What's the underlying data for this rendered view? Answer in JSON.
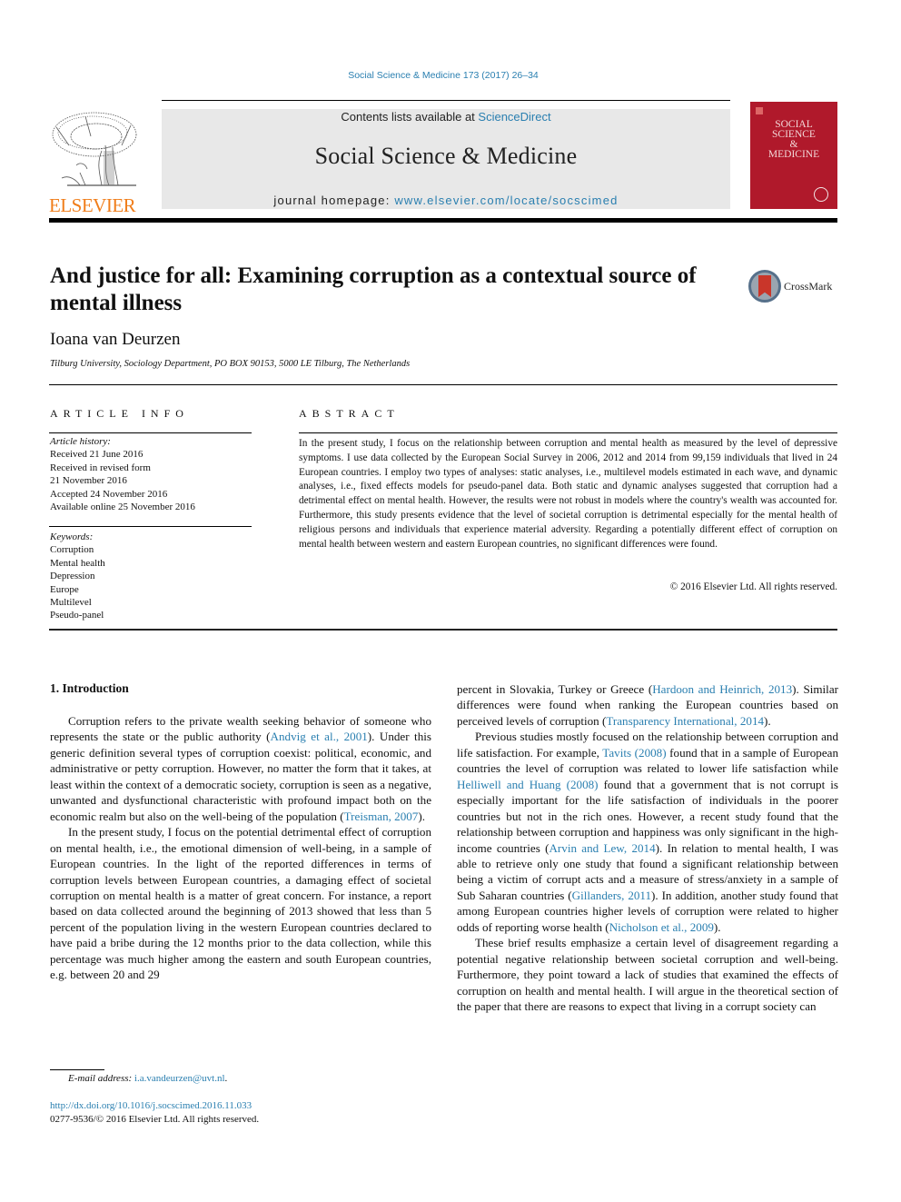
{
  "header": {
    "citation": "Social Science & Medicine 173 (2017) 26–34",
    "contents_prefix": "Contents lists available at ",
    "contents_link": "ScienceDirect",
    "journal_title": "Social Science & Medicine",
    "homepage_prefix": "journal homepage: ",
    "homepage_link": "www.elsevier.com/locate/socscimed",
    "publisher_logo_text": "ELSEVIER",
    "cover_title_lines": [
      "SOCIAL",
      "SCIENCE",
      "&",
      "MEDICINE"
    ],
    "crossmark_label": "CrossMark"
  },
  "colors": {
    "link": "#2a7fb0",
    "elsevier_orange": "#f07d1a",
    "cover_red": "#b0192b",
    "masthead_gray": "#e8e8e8"
  },
  "article": {
    "title": "And justice for all: Examining corruption as a contextual source of mental illness",
    "author": "Ioana van Deurzen",
    "affiliation": "Tilburg University, Sociology Department, PO BOX 90153, 5000 LE Tilburg, The Netherlands"
  },
  "article_info": {
    "heading": "ARTICLE INFO",
    "history_label": "Article history:",
    "history": [
      "Received 21 June 2016",
      "Received in revised form",
      "21 November 2016",
      "Accepted 24 November 2016",
      "Available online 25 November 2016"
    ],
    "keywords_label": "Keywords:",
    "keywords": [
      "Corruption",
      "Mental health",
      "Depression",
      "Europe",
      "Multilevel",
      "Pseudo-panel"
    ]
  },
  "abstract": {
    "heading": "ABSTRACT",
    "text": "In the present study, I focus on the relationship between corruption and mental health as measured by the level of depressive symptoms. I use data collected by the European Social Survey in 2006, 2012 and 2014 from 99,159 individuals that lived in 24 European countries. I employ two types of analyses: static analyses, i.e., multilevel models estimated in each wave, and dynamic analyses, i.e., fixed effects models for pseudo-panel data. Both static and dynamic analyses suggested that corruption had a detrimental effect on mental health. However, the results were not robust in models where the country's wealth was accounted for. Furthermore, this study presents evidence that the level of societal corruption is detrimental especially for the mental health of religious persons and individuals that experience material adversity. Regarding a potentially different effect of corruption on mental health between western and eastern European countries, no significant differences were found.",
    "copyright": "© 2016 Elsevier Ltd. All rights reserved."
  },
  "body": {
    "section_heading": "1.  Introduction",
    "left": {
      "p1": {
        "a": "Corruption refers to the private wealth seeking behavior of someone who represents the state or the public authority (",
        "cite1": "Andvig et al., 2001",
        "b": "). Under this generic definition several types of corruption coexist: political, economic, and administrative or petty corruption. However, no matter the form that it takes, at least within the context of a democratic society, corruption is seen as a negative, unwanted and dysfunctional characteristic with profound impact both on the economic realm but also on the well-being of the population (",
        "cite2": "Treisman, 2007",
        "c": ")."
      },
      "p2": "In the present study, I focus on the potential detrimental effect of corruption on mental health, i.e., the emotional dimension of well-being, in a sample of European countries. In the light of the reported differences in terms of corruption levels between European countries, a damaging effect of societal corruption on mental health is a matter of great concern. For instance, a report based on data collected around the beginning of 2013 showed that less than 5 percent of the population living in the western European countries declared to have paid a bribe during the 12 months prior to the data collection, while this percentage was much higher among the eastern and south European countries, e.g. between 20 and 29"
    },
    "right": {
      "p0": {
        "a": "percent in Slovakia, Turkey or Greece (",
        "cite1": "Hardoon and Heinrich, 2013",
        "b": "). Similar differences were found when ranking the European countries based on perceived levels of corruption (",
        "cite2": "Transparency International, 2014",
        "c": ")."
      },
      "p1": {
        "a": "Previous studies mostly focused on the relationship between corruption and life satisfaction. For example, ",
        "cite1": "Tavits (2008)",
        "b": " found that in a sample of European countries the level of corruption was related to lower life satisfaction while ",
        "cite2": "Helliwell and Huang (2008)",
        "c": " found that a government that is not corrupt is especially important for the life satisfaction of individuals in the poorer countries but not in the rich ones. However, a recent study found that the relationship between corruption and happiness was only significant in the high-income countries (",
        "cite3": "Arvin and Lew, 2014",
        "d": "). In relation to mental health, I was able to retrieve only one study that found a significant relationship between being a victim of corrupt acts and a measure of stress/anxiety in a sample of Sub Saharan countries (",
        "cite4": "Gillanders, 2011",
        "e": "). In addition, another study found that among European countries higher levels of corruption were related to higher odds of reporting worse health (",
        "cite5": "Nicholson et al., 2009",
        "f": ")."
      },
      "p2": "These brief results emphasize a certain level of disagreement regarding a potential negative relationship between societal corruption and well-being. Furthermore, they point toward a lack of studies that examined the effects of corruption on health and mental health. I will argue in the theoretical section of the paper that there are reasons to expect that living in a corrupt society can"
    }
  },
  "footer": {
    "email_label": "E-mail address: ",
    "email": "i.a.vandeurzen@uvt.nl",
    "email_suffix": ".",
    "doi": "http://dx.doi.org/10.1016/j.socscimed.2016.11.033",
    "issn": "0277-9536/© 2016 Elsevier Ltd. All rights reserved."
  }
}
